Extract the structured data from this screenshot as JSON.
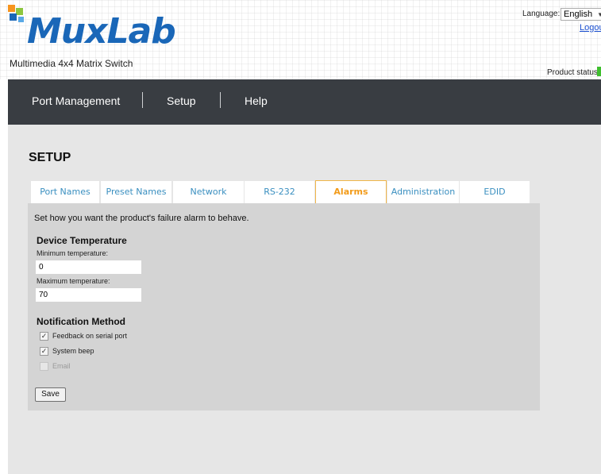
{
  "header": {
    "brand": "MuxLab",
    "tagline": "Multimedia 4x4 Matrix Switch",
    "language_label": "Language:",
    "language_value": "English",
    "logout": "Logout",
    "product_status_label": "Product status:",
    "status_color": "#3fbf2e"
  },
  "nav": {
    "items": [
      "Port Management",
      "Setup",
      "Help"
    ]
  },
  "page": {
    "title": "SETUP"
  },
  "tabs": [
    {
      "label": "Port Names",
      "active": false
    },
    {
      "label": "Preset Names",
      "active": false
    },
    {
      "label": "Network",
      "active": false
    },
    {
      "label": "RS-232",
      "active": false
    },
    {
      "label": "Alarms",
      "active": true
    },
    {
      "label": "Administration",
      "active": false
    },
    {
      "label": "EDID",
      "active": false
    }
  ],
  "panel": {
    "intro": "Set how you want the product's failure alarm to behave.",
    "device_temp_title": "Device Temperature",
    "min_label": "Minimum temperature:",
    "min_value": "0",
    "max_label": "Maximum temperature:",
    "max_value": "70",
    "notification_title": "Notification Method",
    "options": [
      {
        "label": "Feedback on serial port",
        "checked": true,
        "disabled": false
      },
      {
        "label": "System beep",
        "checked": true,
        "disabled": false
      },
      {
        "label": "Email",
        "checked": false,
        "disabled": true
      }
    ],
    "save_label": "Save"
  },
  "colors": {
    "nav_bg": "#393d42",
    "tab_text": "#3a8fc0",
    "tab_active_text": "#f29b1a",
    "brand_blue": "#1a67b8"
  }
}
